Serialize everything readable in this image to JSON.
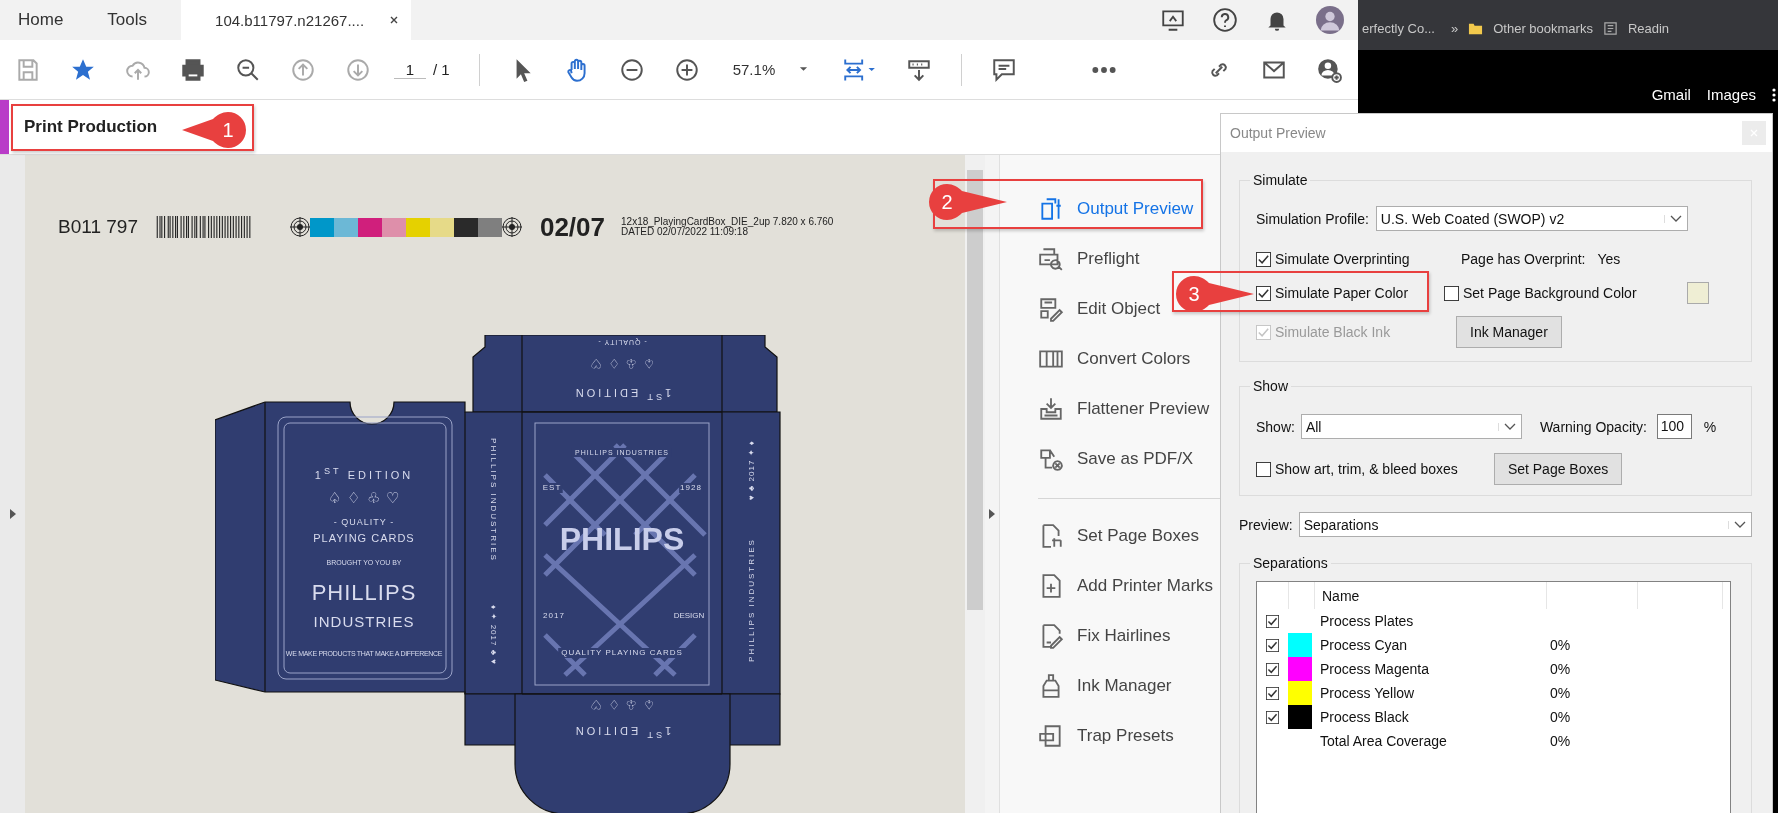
{
  "tab_bar": {
    "tabs": [
      {
        "label": "Home",
        "selected": false,
        "closable": false
      },
      {
        "label": "Tools",
        "selected": false,
        "closable": false
      },
      {
        "label": "104.b11797.n21267....",
        "selected": true,
        "closable": true
      }
    ]
  },
  "toolbar": {
    "page_number": "1",
    "page_total": "/ 1",
    "zoom": "57.1%"
  },
  "panel_title": "Print Production",
  "document": {
    "job_id": "B011 797",
    "color_bar": [
      {
        "color": "#0097c9"
      },
      {
        "color": "#6cb8d6"
      },
      {
        "color": "#d01f7c"
      },
      {
        "color": "#de8faa"
      },
      {
        "color": "#e5d100"
      },
      {
        "color": "#e6da88"
      },
      {
        "color": "#2a2a2a"
      },
      {
        "color": "#7f7f7f"
      }
    ],
    "date_code": "02/07",
    "file_info": "12x18_PlayingCardBox_DIE_2up 7.820 x 6.760",
    "dated": "DATED 02/07/2022 11:09:18",
    "artwork": {
      "top_flap": {
        "quality": "- QUALITY -",
        "suits": "♤ ♧ ♢ ♡",
        "edition": "1$^{ST}$ EDITION"
      },
      "front": {
        "edition": "1$^{ST}$ EDITION",
        "suits": "♤ ♢ ♧ ♡",
        "quality": "- QUALITY -",
        "product": "PLAYING CARDS",
        "byline": "BROUGHT YO YOU BY",
        "brand": "PHILLIPS",
        "brand_sub": "INDUSTRIES",
        "tagline": "WE MAKE PRODUCTS THAT MAKE A DIFFERENCE"
      },
      "left_spine": {
        "brand": "PHILLIPS INDUSTRIES",
        "year": "♦ ✦ 2017 ♣ ♥"
      },
      "back": {
        "banner_top": "PHILLIPS INDUSTRIES",
        "est": "EST",
        "founded": "1928",
        "logo": "PHILIPS",
        "year": "2017",
        "design": "DESIGN",
        "banner_bottom": "QUALITY PLAYING CARDS"
      },
      "right_spine": {
        "year": "♥ ♣ 2017 ✦ ♦",
        "brand": "PHILLIPS INDUSTRIES"
      },
      "bottom_flap": {
        "suits": "♤ ♧ ♢ ♡",
        "edition": "1$^{ST}$ EDITION"
      }
    }
  },
  "tools_pane": {
    "groups": [
      {
        "items": [
          {
            "label": "Output Preview",
            "selected": true
          },
          {
            "label": "Preflight",
            "selected": false
          },
          {
            "label": "Edit Object",
            "selected": false
          },
          {
            "label": "Convert Colors",
            "selected": false
          },
          {
            "label": "Flattener Preview",
            "selected": false
          },
          {
            "label": "Save as PDF/X",
            "selected": false
          }
        ]
      },
      {
        "items": [
          {
            "label": "Set Page Boxes",
            "selected": false
          },
          {
            "label": "Add Printer Marks",
            "selected": false
          },
          {
            "label": "Fix Hairlines",
            "selected": false
          },
          {
            "label": "Ink Manager",
            "selected": false
          },
          {
            "label": "Trap Presets",
            "selected": false
          }
        ]
      }
    ]
  },
  "browser_background": {
    "bookmarks": [
      "erfectly Co...",
      "»",
      "Other bookmarks",
      "Readin"
    ],
    "links": [
      "Gmail",
      "Images"
    ]
  },
  "output_preview": {
    "title": "Output Preview",
    "simulate": {
      "heading": "Simulate",
      "profile_label": "Simulation Profile:",
      "profile_value": "U.S. Web Coated (SWOP) v2",
      "overprinting": {
        "label": "Simulate Overprinting",
        "checked": true,
        "disabled": false
      },
      "overprint_label": "Page has Overprint:",
      "overprint_value": "Yes",
      "paper_color": {
        "label": "Simulate Paper Color",
        "checked": true,
        "disabled": false
      },
      "background_color": {
        "label": "Set Page Background Color",
        "checked": false,
        "disabled": false
      },
      "black_ink": {
        "label": "Simulate Black Ink",
        "checked": true,
        "disabled": true
      },
      "ink_button": "Ink Manager"
    },
    "show": {
      "heading": "Show",
      "show_label": "Show:",
      "show_value": "All",
      "opacity_label": "Warning Opacity:",
      "opacity_value": "100",
      "percent": "%",
      "boxes": {
        "label": "Show art, trim, & bleed boxes",
        "checked": false,
        "disabled": false
      },
      "boxes_button": "Set Page Boxes"
    },
    "preview": {
      "label": "Preview:",
      "value": "Separations"
    },
    "separations": {
      "heading": "Separations",
      "name_header": "Name",
      "rows": [
        {
          "kind": "plate",
          "checked": true,
          "name": "Process Plates"
        },
        {
          "kind": "ink",
          "checked": true,
          "color": "#00ffff",
          "name": "Process Cyan",
          "coverage": "0%"
        },
        {
          "kind": "ink",
          "checked": true,
          "color": "#ff00ff",
          "name": "Process Magenta",
          "coverage": "0%"
        },
        {
          "kind": "ink",
          "checked": true,
          "color": "#ffff00",
          "name": "Process Yellow",
          "coverage": "0%"
        },
        {
          "kind": "ink",
          "checked": true,
          "color": "#000000",
          "name": "Process Black",
          "coverage": "0%"
        },
        {
          "kind": "total",
          "name": "Total Area Coverage",
          "coverage": "0%"
        }
      ]
    }
  },
  "annotations": [
    {
      "number": "1"
    },
    {
      "number": "2"
    },
    {
      "number": "3"
    }
  ]
}
